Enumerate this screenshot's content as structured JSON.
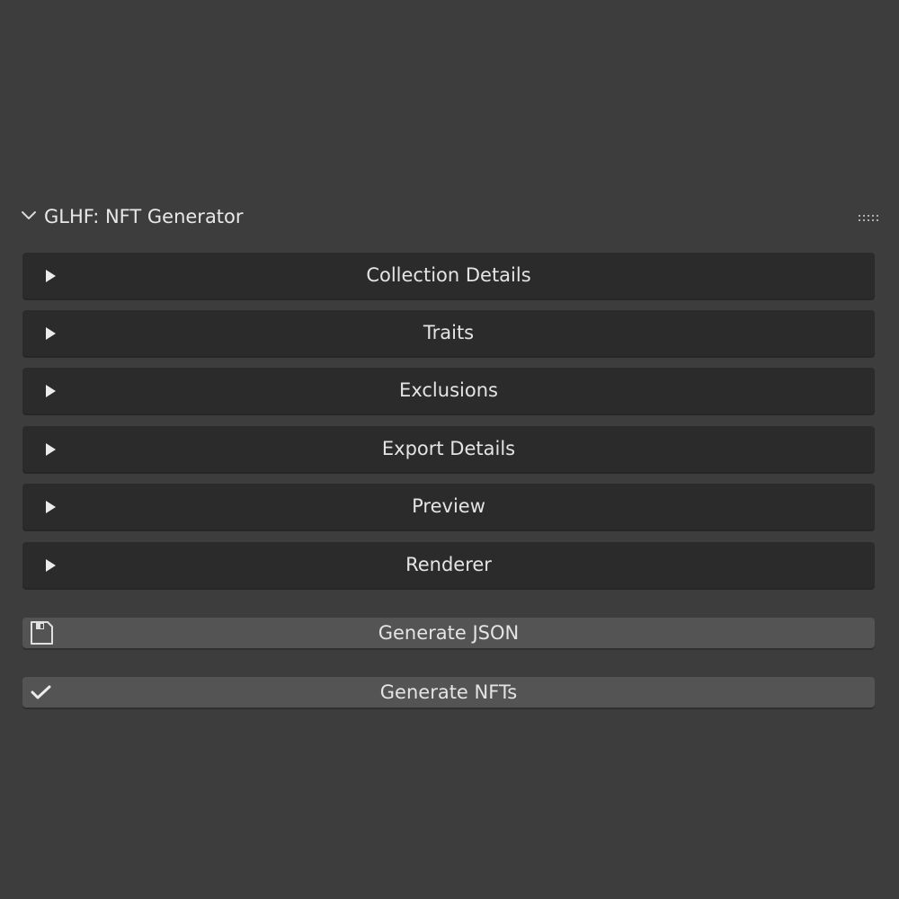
{
  "panel": {
    "title": "GLHF: NFT Generator",
    "expanded": true,
    "header_icon": "chevron-down-icon",
    "drag_icon": "drag-handle-icon"
  },
  "subpanels": [
    {
      "label": "Collection Details",
      "icon": "triangle-right-icon"
    },
    {
      "label": "Traits",
      "icon": "triangle-right-icon"
    },
    {
      "label": "Exclusions",
      "icon": "triangle-right-icon"
    },
    {
      "label": "Export Details",
      "icon": "triangle-right-icon"
    },
    {
      "label": "Preview",
      "icon": "triangle-right-icon"
    },
    {
      "label": "Renderer",
      "icon": "triangle-right-icon"
    }
  ],
  "actions": {
    "generate_json": {
      "label": "Generate JSON",
      "icon": "save-icon"
    },
    "generate_nfts": {
      "label": "Generate NFTs",
      "icon": "checkmark-icon"
    }
  },
  "colors": {
    "background": "#3d3d3d",
    "subpanel_bg": "#2b2b2b",
    "button_bg": "#545454",
    "text": "#e4e4e4"
  }
}
